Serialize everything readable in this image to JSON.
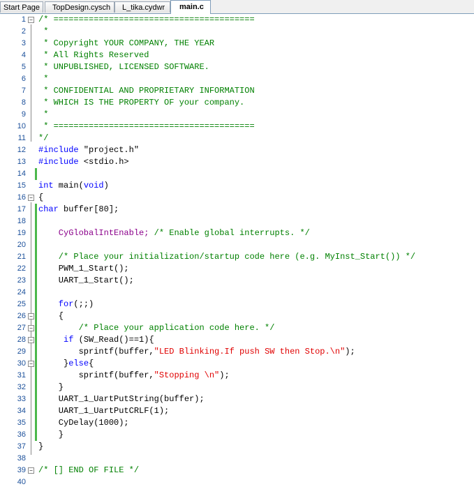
{
  "tabs": [
    {
      "label": "Start Page"
    },
    {
      "label": "TopDesign.cysch"
    },
    {
      "label": "L_tika.cydwr"
    },
    {
      "label": "main.c"
    }
  ],
  "editor": {
    "lines": [
      {
        "n": "1"
      },
      {
        "n": "2"
      },
      {
        "n": "3"
      },
      {
        "n": "4"
      },
      {
        "n": "5"
      },
      {
        "n": "6"
      },
      {
        "n": "7"
      },
      {
        "n": "8"
      },
      {
        "n": "9"
      },
      {
        "n": "10"
      },
      {
        "n": "11"
      },
      {
        "n": "12"
      },
      {
        "n": "13"
      },
      {
        "n": "14"
      },
      {
        "n": "15"
      },
      {
        "n": "16"
      },
      {
        "n": "17"
      },
      {
        "n": "18"
      },
      {
        "n": "19"
      },
      {
        "n": "20"
      },
      {
        "n": "21"
      },
      {
        "n": "22"
      },
      {
        "n": "23"
      },
      {
        "n": "24"
      },
      {
        "n": "25"
      },
      {
        "n": "26"
      },
      {
        "n": "27"
      },
      {
        "n": "28"
      },
      {
        "n": "29"
      },
      {
        "n": "30"
      },
      {
        "n": "31"
      },
      {
        "n": "32"
      },
      {
        "n": "33"
      },
      {
        "n": "34"
      },
      {
        "n": "35"
      },
      {
        "n": "36"
      },
      {
        "n": "37"
      },
      {
        "n": "38"
      },
      {
        "n": "39"
      },
      {
        "n": "40"
      }
    ],
    "code": {
      "l1": "/* ========================================",
      "l2": " *",
      "l3": " * Copyright YOUR COMPANY, THE YEAR",
      "l4": " * All Rights Reserved",
      "l5": " * UNPUBLISHED, LICENSED SOFTWARE.",
      "l6": " *",
      "l7": " * CONFIDENTIAL AND PROPRIETARY INFORMATION",
      "l8": " * WHICH IS THE PROPERTY OF your company.",
      "l9": " *",
      "l10": " * ========================================",
      "l11": "*/",
      "l12_kw": "#include",
      "l12_rest": " \"project.h\"",
      "l13_kw": "#include",
      "l13_rest": " <stdio.h>",
      "l15_kw1": "int",
      "l15_mid": " main(",
      "l15_kw2": "void",
      "l15_end": ")",
      "l16": "{",
      "l17_kw": "char",
      "l17_rest": " buffer[80];",
      "l19_mac": "    CyGlobalIntEnable;",
      "l19_cmt": " /* Enable global interrupts. */",
      "l21": "    /* Place your initialization/startup code here (e.g. MyInst_Start()) */",
      "l22": "    PWM_1_Start();",
      "l23": "    UART_1_Start();",
      "l25_kw": "    for",
      "l25_rest": "(;;)",
      "l26": "    {",
      "l27": "        /* Place your application code here. */",
      "l28_kw": "     if",
      "l28_rest": " (SW_Read()==1){",
      "l29_a": "        sprintf(buffer,",
      "l29_str": "\"LED Blinking.If push SW then Stop.\\n\"",
      "l29_b": ");",
      "l30_a": "     }",
      "l30_kw": "else",
      "l30_b": "{",
      "l31_a": "        sprintf(buffer,",
      "l31_str": "\"Stopping \\n\"",
      "l31_b": ");",
      "l32": "    }",
      "l33": "    UART_1_UartPutString(buffer);",
      "l34": "    UART_1_UartPutCRLF(1);",
      "l35": "    CyDelay(1000);",
      "l36": "    }",
      "l37": "}",
      "l39": "/* [] END OF FILE */"
    },
    "colors": {
      "comment": "#008000",
      "keyword": "#0000ff",
      "string": "#e00000",
      "macro": "#8b008b",
      "line_number": "#1a4f9a",
      "change_bar": "#4cb84c"
    }
  }
}
